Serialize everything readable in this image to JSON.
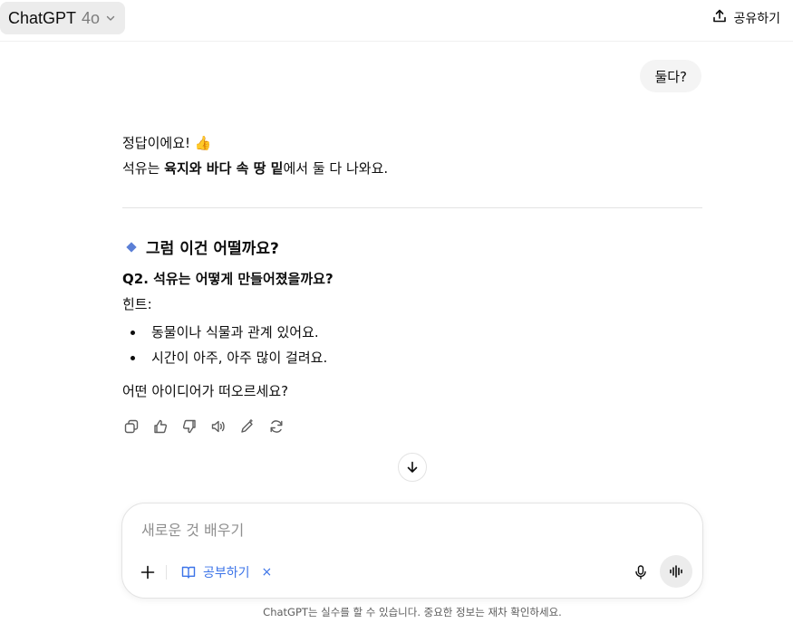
{
  "header": {
    "model_name": "ChatGPT",
    "model_version": "4o",
    "share_label": "공유하기"
  },
  "conversation": {
    "user_message": "둘다?",
    "answer_line1": "정답이에요!",
    "answer_emoji": "👍",
    "answer_line2_pre": "석유는 ",
    "answer_line2_bold": "육지와 바다 속 땅 밑",
    "answer_line2_post": "에서 둘 다 나와요.",
    "section_heading": "그럼 이건 어떨까요?",
    "question": "Q2. 석유는 어떻게 만들어졌을까요?",
    "hint_label": "힌트:",
    "hints": [
      "동물이나 식물과 관계 있어요.",
      "시간이 아주, 아주 많이 걸려요."
    ],
    "closing": "어떤 아이디어가 떠오르세요?"
  },
  "composer": {
    "placeholder": "새로운 것 배우기",
    "tool_chip": "공부하기",
    "tool_chip_close": "×"
  },
  "footer": {
    "disclaimer": "ChatGPT는 실수를 할 수 있습니다. 중요한 정보는 재차 확인하세요."
  },
  "colors": {
    "accent": "#3b73e8",
    "bubble_bg": "#f4f4f4",
    "diamond": "#5b7fd6"
  }
}
